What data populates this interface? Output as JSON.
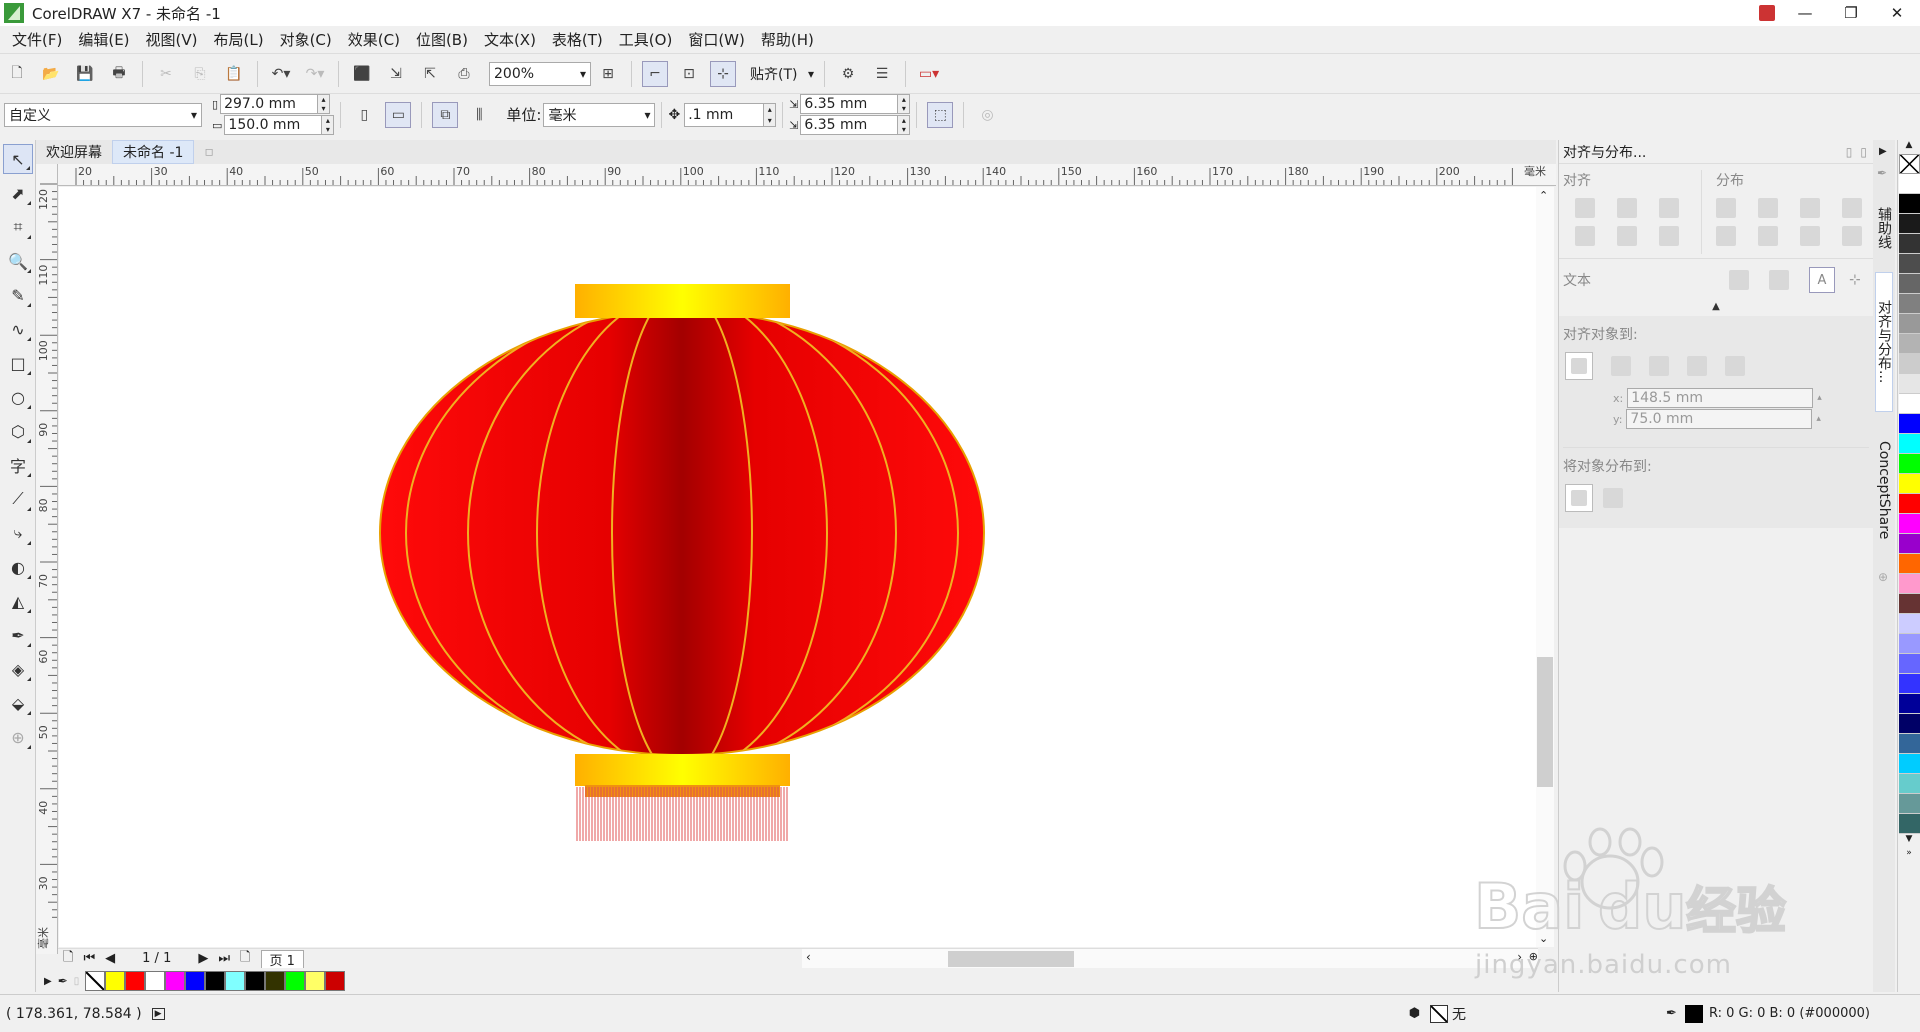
{
  "window": {
    "title": "CorelDRAW X7 - 未命名 -1",
    "controls": [
      "—",
      "❐",
      "✕"
    ]
  },
  "menu": [
    "文件(F)",
    "编辑(E)",
    "视图(V)",
    "布局(L)",
    "对象(C)",
    "效果(C)",
    "位图(B)",
    "文本(X)",
    "表格(T)",
    "工具(O)",
    "窗口(W)",
    "帮助(H)"
  ],
  "toolbar1": {
    "zoom": "200%",
    "snap_label": "贴齐(T)"
  },
  "toolbar2": {
    "page_preset": "自定义",
    "width": "297.0 mm",
    "height": "150.0 mm",
    "units_label": "单位:",
    "units_value": "毫米",
    "nudge": ".1 mm",
    "dup_x": "6.35 mm",
    "dup_y": "6.35 mm"
  },
  "doc_tabs": [
    "欢迎屏幕",
    "未命名 -1"
  ],
  "ruler": {
    "h_ticks": [
      "20",
      "30",
      "40",
      "50",
      "60",
      "70",
      "80",
      "90",
      "100",
      "110",
      "120",
      "130",
      "140",
      "150",
      "160",
      "170",
      "180",
      "190",
      "200"
    ],
    "h_unit": "毫米",
    "v_ticks": [
      "120",
      "110",
      "100",
      "90",
      "80",
      "70",
      "60",
      "50",
      "40",
      "30"
    ],
    "v_unit": "毫米"
  },
  "page_nav": {
    "pages": "1 / 1",
    "page_tab": "页 1"
  },
  "doc_palette": [
    "none",
    "#ffff00",
    "#ff0000",
    "#ffffff",
    "#ff00ff",
    "#0000ff",
    "#000000",
    "#80ffff",
    "#000000",
    "#333300",
    "#00ff00",
    "#ffff66",
    "#cc0000"
  ],
  "status": {
    "coords": "( 178.361, 78.584 )",
    "fill_label": "无",
    "outline": "R: 0 G: 0 B: 0 (#000000)"
  },
  "dock": {
    "title": "对齐与分布...",
    "align_label": "对齐",
    "distribute_label": "分布",
    "text_label": "文本",
    "align_to_label": "对齐对象到:",
    "x": "148.5 mm",
    "y": "75.0 mm",
    "distribute_to_label": "将对象分布到:"
  },
  "side_tabs": [
    "辅助线",
    "对齐与分布...",
    "ConceptShare"
  ],
  "right_palette": [
    "#ffffff",
    "#000000",
    "#1a1a1a",
    "#333333",
    "#4d4d4d",
    "#666666",
    "#808080",
    "#999999",
    "#b3b3b3",
    "#cccccc",
    "#e6e6e6",
    "#ffffff",
    "#0000ff",
    "#00ffff",
    "#00ff00",
    "#ffff00",
    "#ff0000",
    "#ff00ff",
    "#9900cc",
    "#ff6600",
    "#ff99cc",
    "#663333",
    "#ccccff",
    "#9999ff",
    "#6666ff",
    "#3333ff",
    "#000099",
    "#000066",
    "#336699",
    "#00ccff",
    "#66cccc",
    "#669999",
    "#336666"
  ],
  "watermark": {
    "text": "jingyan.baidu.com",
    "brand_a": "Bai",
    "brand_b": "du",
    "brand_c": "经验"
  },
  "colors": {
    "lantern_red": "#ee1111",
    "lantern_dark": "#b00000",
    "gold": "#ffcc00",
    "accent": "#dde8f8"
  }
}
